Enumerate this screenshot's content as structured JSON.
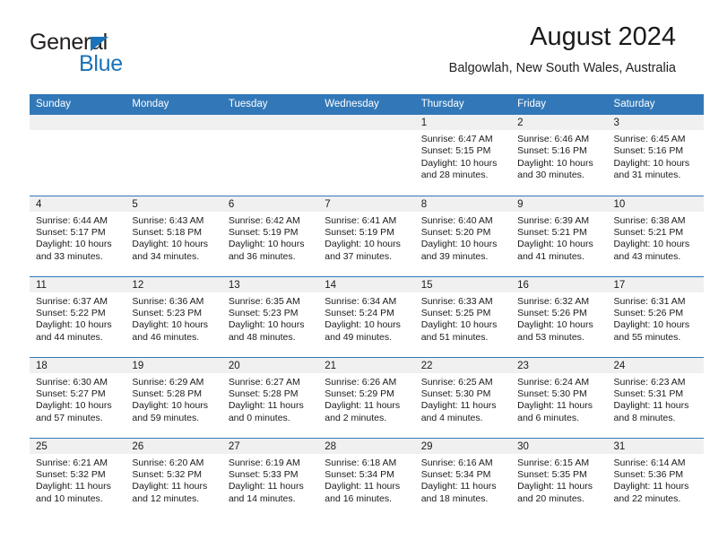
{
  "logo": {
    "word_top": "General",
    "word_bottom": "Blue",
    "triangle_color": "#1b72b8",
    "text_color": "#231f20"
  },
  "header": {
    "title": "August 2024",
    "subtitle": "Balgowlah, New South Wales, Australia"
  },
  "theme": {
    "header_blue": "#3278b8",
    "daynum_band": "#f0f0f0",
    "text": "#1a1a1a"
  },
  "weekdays": [
    "Sunday",
    "Monday",
    "Tuesday",
    "Wednesday",
    "Thursday",
    "Friday",
    "Saturday"
  ],
  "weeks": [
    [
      {
        "empty": true
      },
      {
        "empty": true
      },
      {
        "empty": true
      },
      {
        "empty": true
      },
      {
        "day": "1",
        "sunrise": "Sunrise: 6:47 AM",
        "sunset": "Sunset: 5:15 PM",
        "daylight": "Daylight: 10 hours and 28 minutes."
      },
      {
        "day": "2",
        "sunrise": "Sunrise: 6:46 AM",
        "sunset": "Sunset: 5:16 PM",
        "daylight": "Daylight: 10 hours and 30 minutes."
      },
      {
        "day": "3",
        "sunrise": "Sunrise: 6:45 AM",
        "sunset": "Sunset: 5:16 PM",
        "daylight": "Daylight: 10 hours and 31 minutes."
      }
    ],
    [
      {
        "day": "4",
        "sunrise": "Sunrise: 6:44 AM",
        "sunset": "Sunset: 5:17 PM",
        "daylight": "Daylight: 10 hours and 33 minutes."
      },
      {
        "day": "5",
        "sunrise": "Sunrise: 6:43 AM",
        "sunset": "Sunset: 5:18 PM",
        "daylight": "Daylight: 10 hours and 34 minutes."
      },
      {
        "day": "6",
        "sunrise": "Sunrise: 6:42 AM",
        "sunset": "Sunset: 5:19 PM",
        "daylight": "Daylight: 10 hours and 36 minutes."
      },
      {
        "day": "7",
        "sunrise": "Sunrise: 6:41 AM",
        "sunset": "Sunset: 5:19 PM",
        "daylight": "Daylight: 10 hours and 37 minutes."
      },
      {
        "day": "8",
        "sunrise": "Sunrise: 6:40 AM",
        "sunset": "Sunset: 5:20 PM",
        "daylight": "Daylight: 10 hours and 39 minutes."
      },
      {
        "day": "9",
        "sunrise": "Sunrise: 6:39 AM",
        "sunset": "Sunset: 5:21 PM",
        "daylight": "Daylight: 10 hours and 41 minutes."
      },
      {
        "day": "10",
        "sunrise": "Sunrise: 6:38 AM",
        "sunset": "Sunset: 5:21 PM",
        "daylight": "Daylight: 10 hours and 43 minutes."
      }
    ],
    [
      {
        "day": "11",
        "sunrise": "Sunrise: 6:37 AM",
        "sunset": "Sunset: 5:22 PM",
        "daylight": "Daylight: 10 hours and 44 minutes."
      },
      {
        "day": "12",
        "sunrise": "Sunrise: 6:36 AM",
        "sunset": "Sunset: 5:23 PM",
        "daylight": "Daylight: 10 hours and 46 minutes."
      },
      {
        "day": "13",
        "sunrise": "Sunrise: 6:35 AM",
        "sunset": "Sunset: 5:23 PM",
        "daylight": "Daylight: 10 hours and 48 minutes."
      },
      {
        "day": "14",
        "sunrise": "Sunrise: 6:34 AM",
        "sunset": "Sunset: 5:24 PM",
        "daylight": "Daylight: 10 hours and 49 minutes."
      },
      {
        "day": "15",
        "sunrise": "Sunrise: 6:33 AM",
        "sunset": "Sunset: 5:25 PM",
        "daylight": "Daylight: 10 hours and 51 minutes."
      },
      {
        "day": "16",
        "sunrise": "Sunrise: 6:32 AM",
        "sunset": "Sunset: 5:26 PM",
        "daylight": "Daylight: 10 hours and 53 minutes."
      },
      {
        "day": "17",
        "sunrise": "Sunrise: 6:31 AM",
        "sunset": "Sunset: 5:26 PM",
        "daylight": "Daylight: 10 hours and 55 minutes."
      }
    ],
    [
      {
        "day": "18",
        "sunrise": "Sunrise: 6:30 AM",
        "sunset": "Sunset: 5:27 PM",
        "daylight": "Daylight: 10 hours and 57 minutes."
      },
      {
        "day": "19",
        "sunrise": "Sunrise: 6:29 AM",
        "sunset": "Sunset: 5:28 PM",
        "daylight": "Daylight: 10 hours and 59 minutes."
      },
      {
        "day": "20",
        "sunrise": "Sunrise: 6:27 AM",
        "sunset": "Sunset: 5:28 PM",
        "daylight": "Daylight: 11 hours and 0 minutes."
      },
      {
        "day": "21",
        "sunrise": "Sunrise: 6:26 AM",
        "sunset": "Sunset: 5:29 PM",
        "daylight": "Daylight: 11 hours and 2 minutes."
      },
      {
        "day": "22",
        "sunrise": "Sunrise: 6:25 AM",
        "sunset": "Sunset: 5:30 PM",
        "daylight": "Daylight: 11 hours and 4 minutes."
      },
      {
        "day": "23",
        "sunrise": "Sunrise: 6:24 AM",
        "sunset": "Sunset: 5:30 PM",
        "daylight": "Daylight: 11 hours and 6 minutes."
      },
      {
        "day": "24",
        "sunrise": "Sunrise: 6:23 AM",
        "sunset": "Sunset: 5:31 PM",
        "daylight": "Daylight: 11 hours and 8 minutes."
      }
    ],
    [
      {
        "day": "25",
        "sunrise": "Sunrise: 6:21 AM",
        "sunset": "Sunset: 5:32 PM",
        "daylight": "Daylight: 11 hours and 10 minutes."
      },
      {
        "day": "26",
        "sunrise": "Sunrise: 6:20 AM",
        "sunset": "Sunset: 5:32 PM",
        "daylight": "Daylight: 11 hours and 12 minutes."
      },
      {
        "day": "27",
        "sunrise": "Sunrise: 6:19 AM",
        "sunset": "Sunset: 5:33 PM",
        "daylight": "Daylight: 11 hours and 14 minutes."
      },
      {
        "day": "28",
        "sunrise": "Sunrise: 6:18 AM",
        "sunset": "Sunset: 5:34 PM",
        "daylight": "Daylight: 11 hours and 16 minutes."
      },
      {
        "day": "29",
        "sunrise": "Sunrise: 6:16 AM",
        "sunset": "Sunset: 5:34 PM",
        "daylight": "Daylight: 11 hours and 18 minutes."
      },
      {
        "day": "30",
        "sunrise": "Sunrise: 6:15 AM",
        "sunset": "Sunset: 5:35 PM",
        "daylight": "Daylight: 11 hours and 20 minutes."
      },
      {
        "day": "31",
        "sunrise": "Sunrise: 6:14 AM",
        "sunset": "Sunset: 5:36 PM",
        "daylight": "Daylight: 11 hours and 22 minutes."
      }
    ]
  ]
}
